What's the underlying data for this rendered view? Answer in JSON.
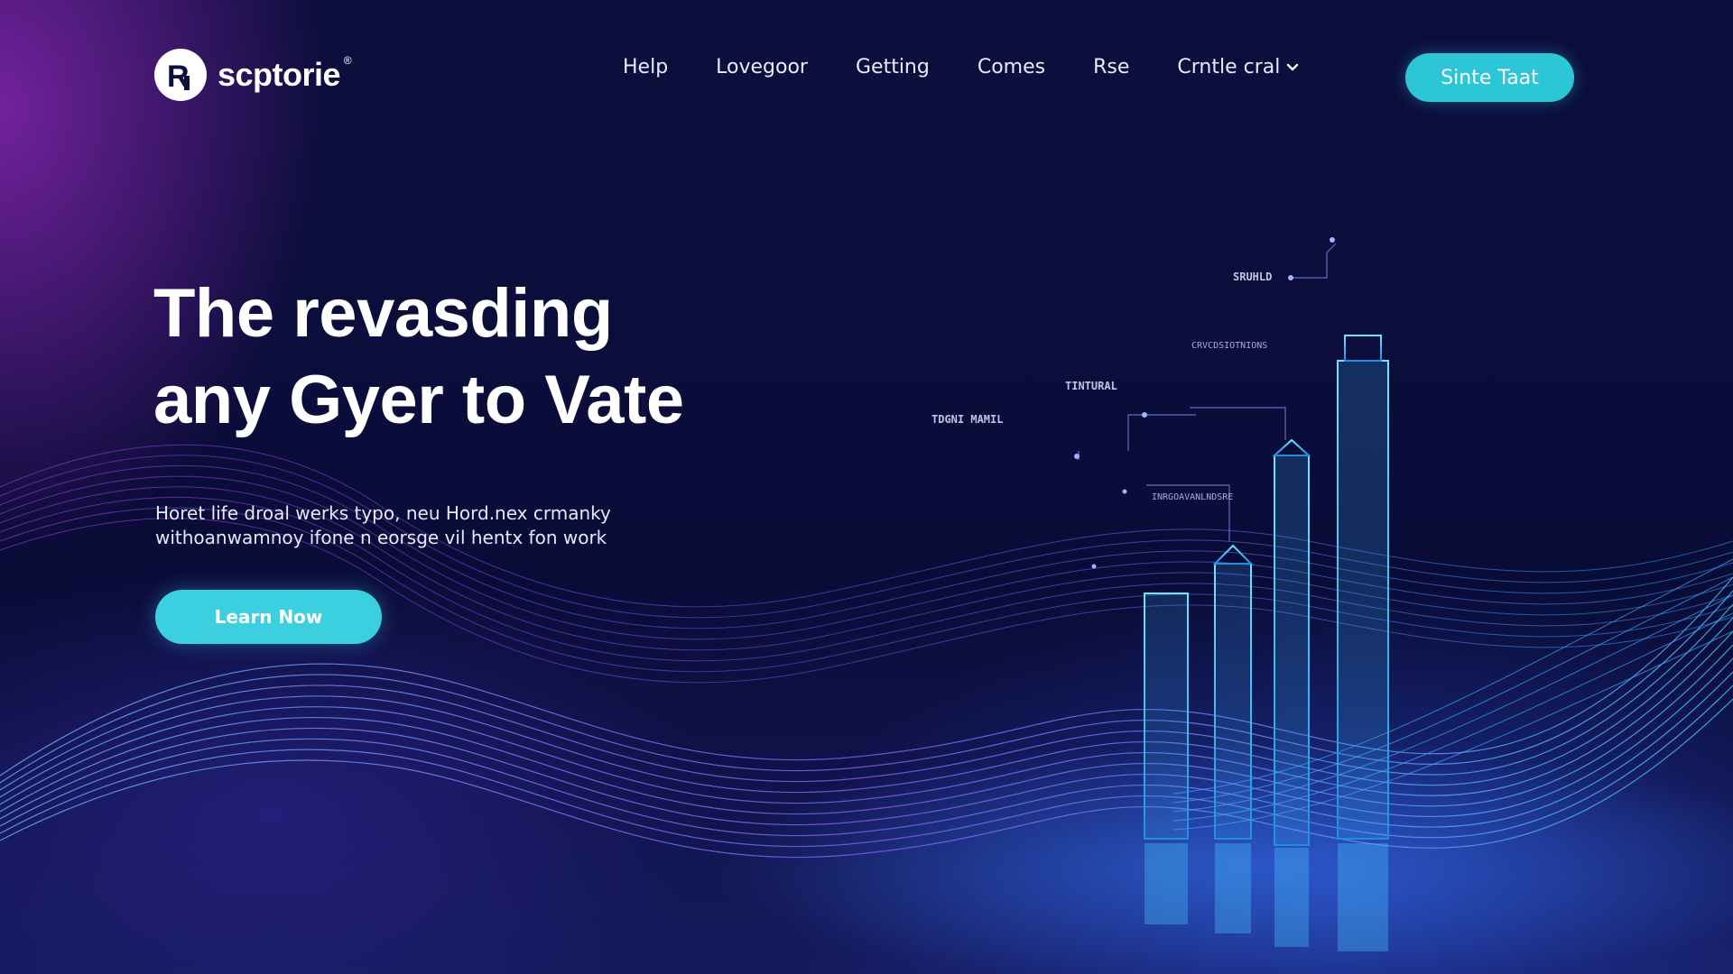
{
  "brand": {
    "name": "scptorie",
    "registered_mark": "®"
  },
  "nav": {
    "items": [
      {
        "label": "Help"
      },
      {
        "label": "Lovegoor"
      },
      {
        "label": "Getting"
      },
      {
        "label": "Comes"
      },
      {
        "label": "Rse"
      },
      {
        "label": "Crntle cral",
        "has_dropdown": true
      }
    ],
    "cta_label": "Sinte Taat"
  },
  "hero": {
    "title_line1": "The revasding",
    "title_line2": "any Gyer to Vate",
    "subtitle_line1": "Horet life droal werks typo, neu Hord.nex crmanky",
    "subtitle_line2": "withoanwamnoy ifone n eorsge vil hentx fon work",
    "cta_label": "Learn Now"
  },
  "illustration": {
    "labels": {
      "l1": "TDGNI MAMIL",
      "l2": "SRUHLD",
      "l3": "TINTURAL",
      "l4": "CRVCDSIOTNIONS",
      "l5": "INRGOAVANLNDSRE"
    }
  },
  "colors": {
    "background": "#0b0d3a",
    "accent": "#2cc6d6",
    "purple_glow": "#9628be",
    "wave_blue": "#3aa0ff"
  }
}
